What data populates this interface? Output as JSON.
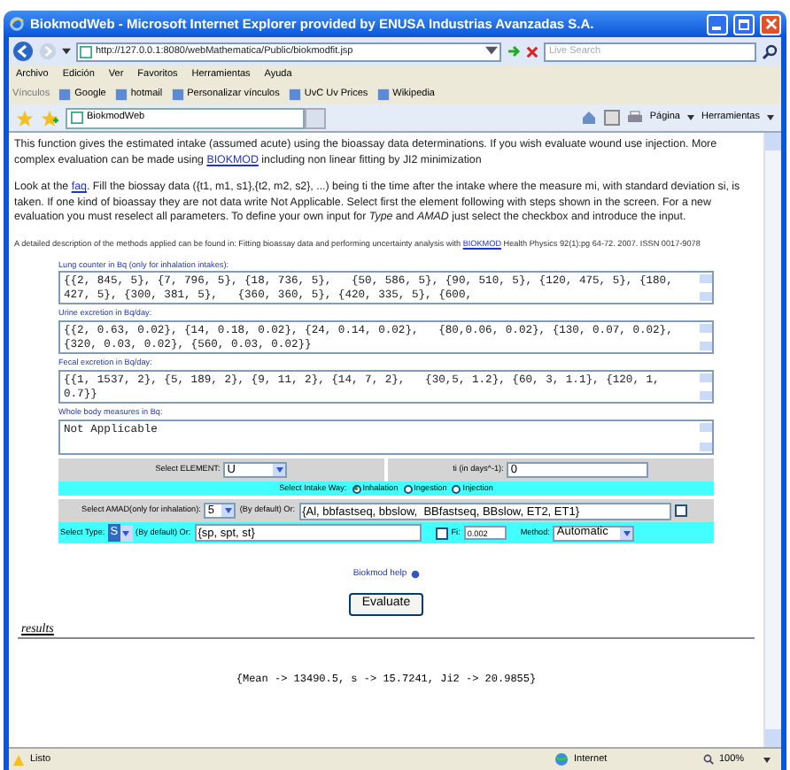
{
  "window": {
    "title": "BiokmodWeb - Microsoft Internet Explorer provided by ENUSA Industrias Avanzadas S.A."
  },
  "address_bar": {
    "url": "http://127.0.0.1:8080/webMathematica/Public/biokmodfit.jsp",
    "search_placeholder": "Live Search"
  },
  "menu": [
    "Archivo",
    "Edición",
    "Ver",
    "Favoritos",
    "Herramientas",
    "Ayuda"
  ],
  "links_bar": {
    "label": "Vínculos",
    "items": [
      "Google",
      "hotmail",
      "Personalizar vínculos",
      "UvC Uv Prices",
      "Wikipedia"
    ]
  },
  "tabs": [
    {
      "title": "BiokmodWeb",
      "selected": true
    }
  ],
  "command_bar": [
    "Página",
    "Herramientas"
  ],
  "intro": [
    {
      "kind": "body",
      "parts": [
        {
          "kind": "text",
          "text": "This function gives the estimated intake (assumed acute) using the bioassay data determinations. If you wish evaluate wound use injection. More complex evaluation can be made using "
        },
        {
          "kind": "link",
          "text": "BIOKMOD"
        },
        {
          "kind": "text",
          "text": " including non linear fitting by JI2 minimization"
        }
      ]
    },
    {
      "kind": "body",
      "parts": [
        {
          "kind": "text",
          "text": "Look at the "
        },
        {
          "kind": "link",
          "text": "faq"
        },
        {
          "kind": "text",
          "text": ". Fill the biossay data ({t1, m1, s1},{t2, m2, s2}, ...) being ti the time after the intake where the measure mi, with standard deviation si, is taken. If one kind of bioassay they are not data write Not Applicable. Select first the element following with steps shown in the screen. For a new evaluation you must reselect all parameters. To define your own input for *Type* and *AMAD* just select the checkbox and introduce the input."
        }
      ]
    },
    {
      "kind": "note",
      "parts": [
        {
          "kind": "text",
          "text": "A detailed description of the methods applied can be found in: Fitting bioassay data and performing uncertainty analysis with "
        },
        {
          "kind": "link",
          "text": "BIOKMOD"
        },
        {
          "kind": "text",
          "text": " Health Physics 92(1):pg 64-72. 2007. ISSN 0017-9078"
        }
      ]
    }
  ],
  "form": {
    "textareas": [
      {
        "label": "Lung counter in Bq (only for inhalation intakes):",
        "value": "{{2, 845, 5}, {7, 796, 5}, {18, 736, 5},   {50, 586, 5}, {90, 510, 5}, {120, 475, 5}, {180, 427, 5}, {300, 381, 5},   {360, 360, 5}, {420, 335, 5}, {600,"
      },
      {
        "label": "Urine excretion in Bq/day:",
        "value": "{{2, 0.63, 0.02}, {14, 0.18, 0.02}, {24, 0.14, 0.02},   {80,0.06, 0.02}, {130, 0.07, 0.02}, {320, 0.03, 0.02}, {560, 0.03, 0.02}}"
      },
      {
        "label": "Fecal excretion in Bq/day:",
        "value": "{{1, 1537, 2}, {5, 189, 2}, {9, 11, 2}, {14, 7, 2},   {30,5, 1.2}, {60, 3, 1.1}, {120, 1, 0.7}}"
      },
      {
        "label": "Whole body measures in Bq:",
        "value": "Not Applicable"
      }
    ],
    "element": {
      "label": "Select ELEMENT:",
      "value": "U"
    },
    "ti": {
      "label": "ti (in days^-1):",
      "value": "0"
    },
    "intake_way": {
      "label": "Select Intake Way:",
      "options": [
        {
          "label": "Inhalation",
          "selected": true
        },
        {
          "label": "Ingestion",
          "selected": false
        },
        {
          "label": "Injection",
          "selected": false
        }
      ]
    },
    "amad": {
      "label": "Select AMAD(only for inhalation):",
      "value": "5",
      "or_label": "(By default) Or:",
      "custom": "{Al, bbfastseq, bbslow,  BBfastseq, BBslow, ET2, ET1}",
      "checked": false
    },
    "type": {
      "label": "Select Type:",
      "value": "S",
      "or_label": "(By default) Or:",
      "custom": "{sp, spt, st}",
      "checked": false
    },
    "fi": {
      "label": "Fi:",
      "value": "0.002"
    },
    "method": {
      "label": "Method:",
      "value": "Automatic"
    }
  },
  "help_link": "Biokmod help",
  "evaluate_button": "Evaluate",
  "results": {
    "heading": "results",
    "value": "{Mean -> 13490.5, s -> 15.7241, Ji2 -> 20.9855}"
  },
  "status_bar": {
    "text": "Listo",
    "zone": "Internet",
    "zoom": "100%"
  }
}
